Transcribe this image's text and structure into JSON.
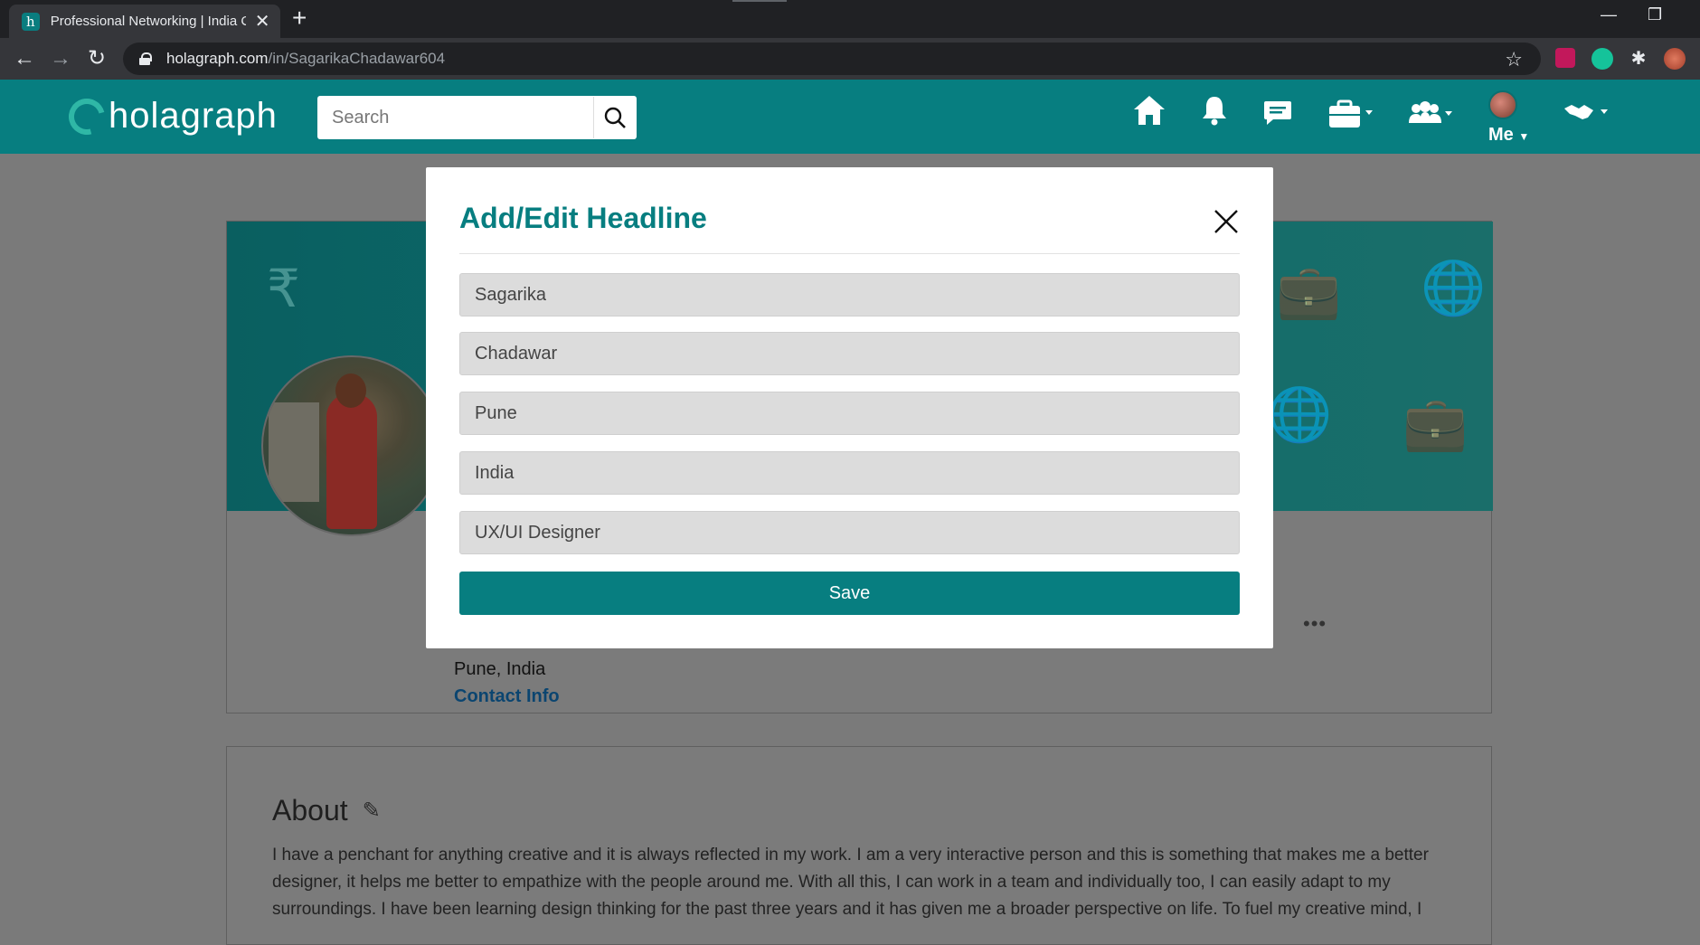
{
  "browser": {
    "tab_title": "Professional Networking | India C",
    "tab_favicon_letter": "h",
    "url_host": "holagraph.com",
    "url_path": "/in/SagarikaChadawar604"
  },
  "header": {
    "logo_text": "holagraph",
    "search_placeholder": "Search",
    "me_label": "Me",
    "icons": [
      "home-icon",
      "bell-icon",
      "messages-icon",
      "briefcase-icon",
      "network-icon",
      "handshake-icon"
    ]
  },
  "profile": {
    "location": "Pune, India",
    "contact_link": "Contact Info",
    "more": "•••"
  },
  "about": {
    "title": "About",
    "text": "I have a penchant for anything creative and it is always reflected in my work. I am a very interactive person and this is something that makes me a better designer, it helps me better to empathize with the people around me. With all this, I can work in a team and individually too, I can easily adapt to my surroundings. I have been learning design thinking for the past three years and it has given me a broader perspective on life. To fuel my creative mind, I"
  },
  "modal": {
    "title": "Add/Edit Headline",
    "fields": [
      {
        "name": "first-name",
        "value": "Sagarika"
      },
      {
        "name": "last-name",
        "value": "Chadawar"
      },
      {
        "name": "city",
        "value": "Pune"
      },
      {
        "name": "country",
        "value": "India"
      },
      {
        "name": "headline",
        "value": "UX/UI Designer"
      }
    ],
    "save_label": "Save"
  },
  "colors": {
    "brand_teal": "#077e80",
    "overlay_gray": "#7a7a7a"
  }
}
